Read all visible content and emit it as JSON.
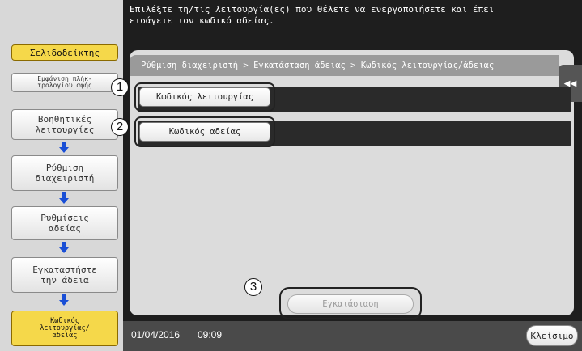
{
  "instruction": "Επιλέξτε τη/τις λειτουργία(ες) που θέλετε να ενεργοποιήσετε και έπει\nεισάγετε τον κωδικό αδείας.",
  "sidebar": {
    "bookmark_label": "Σελιδοδείκτης",
    "number_display_label": "Εμφάνιση πλήκ-\nτρολογίου αφής",
    "steps": [
      {
        "label": "Βοηθητικές\nλειτουργίες"
      },
      {
        "label": "Ρύθμιση\nδιαχειριστή"
      },
      {
        "label": "Ρυθμίσεις\nαδείας"
      },
      {
        "label": "Εγκαταστήστε\nτην άδεια"
      },
      {
        "label": "Κωδικός\nλειτουργίας/\nαδείας"
      }
    ]
  },
  "breadcrumb": "Ρύθμιση διαχειριστή > Εγκατάσταση άδειας > Κωδικός λειτουργίας/άδειας",
  "fields": {
    "function_code_label": "Κωδικός λειτουργίας",
    "function_code_value": "",
    "license_code_label": "Κωδικός αδείας",
    "license_code_value": ""
  },
  "install_label": "Εγκατάσταση",
  "callouts": [
    "1",
    "2",
    "3"
  ],
  "status": {
    "date": "01/04/2016",
    "time": "09:09"
  },
  "close_label": "Κλείσιμο",
  "colors": {
    "highlight": "#f5d84a",
    "arrow": "#1a4fd6",
    "dark_bg": "#1e1e1e"
  }
}
